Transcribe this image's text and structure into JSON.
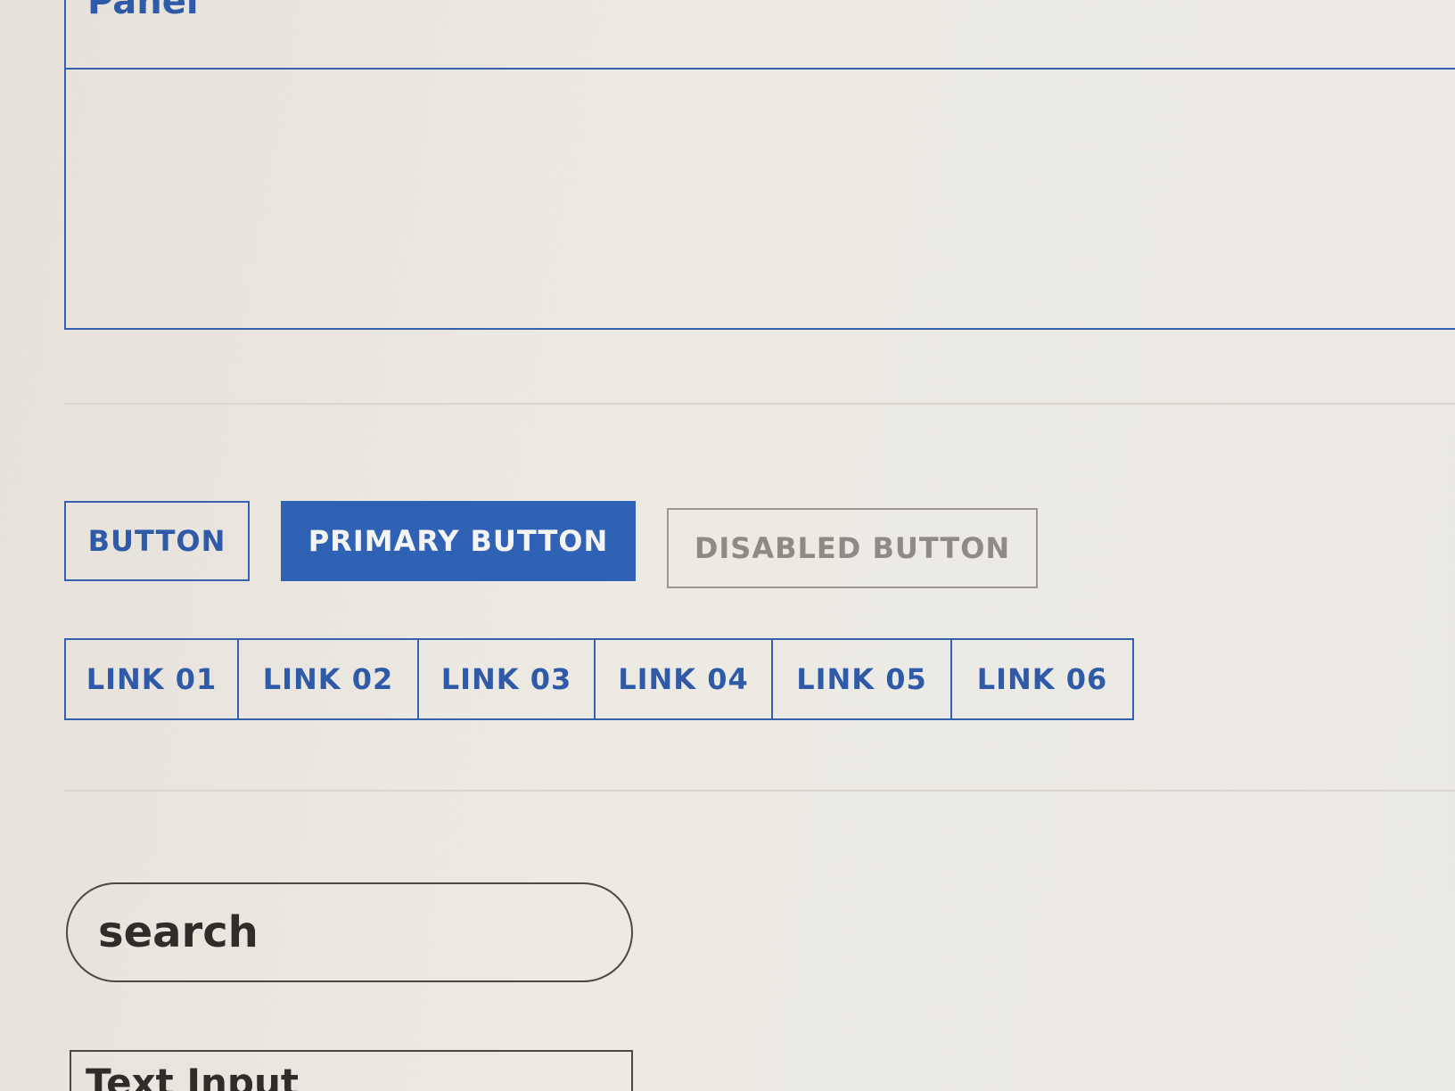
{
  "panel": {
    "title": "Panel"
  },
  "buttons": {
    "default_label": "BUTTON",
    "primary_label": "PRIMARY BUTTON",
    "disabled_label": "DISABLED BUTTON"
  },
  "links": [
    {
      "label": "LINK 01"
    },
    {
      "label": "LINK 02"
    },
    {
      "label": "LINK 03"
    },
    {
      "label": "LINK 04"
    },
    {
      "label": "LINK 05"
    },
    {
      "label": "LINK 06"
    }
  ],
  "search": {
    "placeholder": "search"
  },
  "text_input": {
    "label": "Text Input"
  },
  "colors": {
    "accent": "#2f62b4",
    "outline": "#3562b0",
    "disabled": "#9a9691",
    "background": "#ebe8e2"
  }
}
